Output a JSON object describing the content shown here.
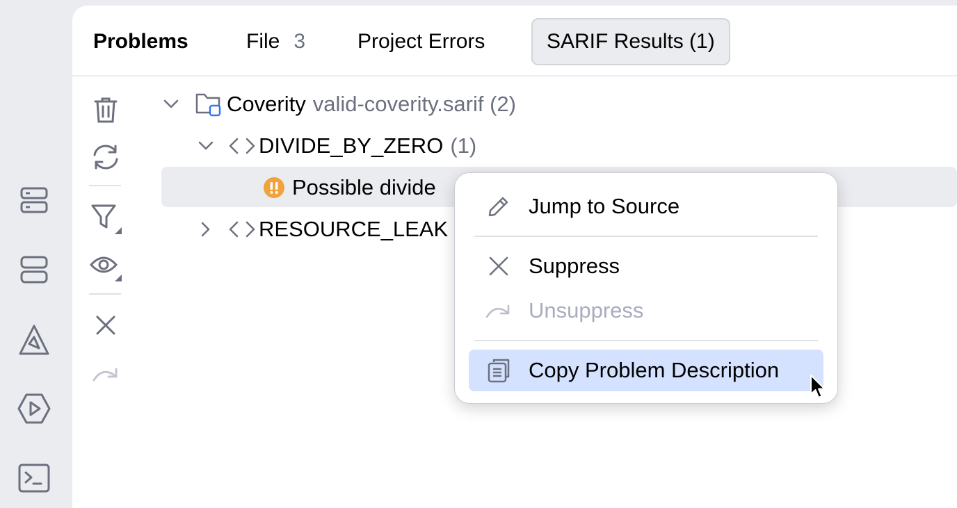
{
  "tabs": {
    "title": "Problems",
    "file_label": "File",
    "file_count": "3",
    "project_errors": "Project Errors",
    "sarif_results": "SARIF Results (1)"
  },
  "tree": {
    "root": {
      "name": "Coverity",
      "file": "valid-coverity.sarif (2)"
    },
    "divide": {
      "name": "DIVIDE_BY_ZERO",
      "count": "(1)"
    },
    "problem": {
      "text": "Possible divide"
    },
    "leak": {
      "name": "RESOURCE_LEAK"
    }
  },
  "menu": {
    "jump": "Jump to Source",
    "suppress": "Suppress",
    "unsuppress": "Unsuppress",
    "copy": "Copy Problem Description"
  },
  "icons": {
    "left_strip": [
      "database-icon",
      "structure-icon",
      "build-icon",
      "run-icon",
      "terminal-icon"
    ],
    "toolbar": [
      "trash-icon",
      "refresh-icon",
      "filter-icon",
      "eye-icon",
      "close-icon",
      "redo-icon"
    ]
  },
  "colors": {
    "accent": "#3574f0",
    "warning": "#f2a23c",
    "menu_highlight": "#d4e2ff"
  }
}
